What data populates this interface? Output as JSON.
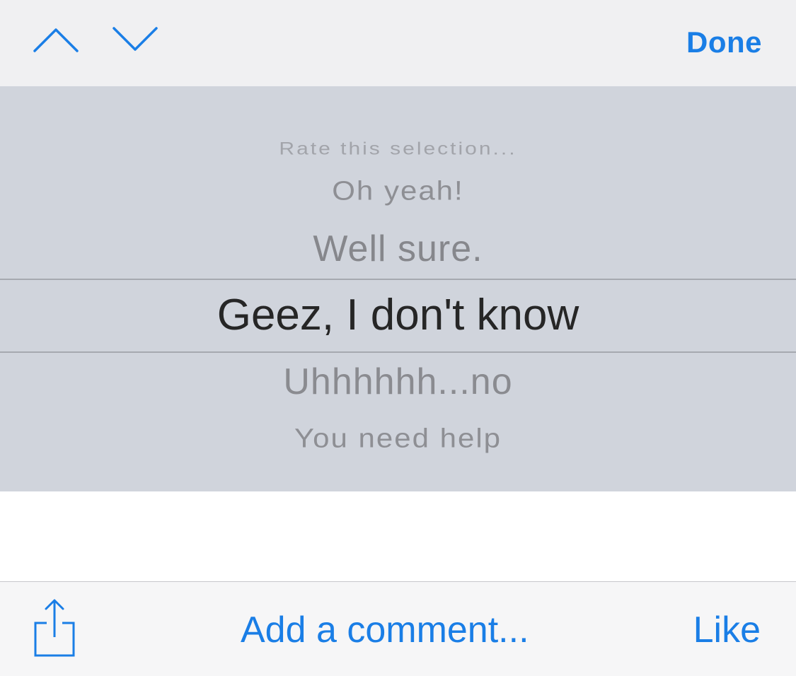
{
  "toolbar": {
    "prev_icon": "chevron-up-icon",
    "next_icon": "chevron-down-icon",
    "done_label": "Done"
  },
  "picker": {
    "options": [
      "Rate this selection...",
      "Oh yeah!",
      "Well sure.",
      "Geez, I don't know",
      "Uhhhhhh...no",
      "You need help"
    ],
    "selected": "Geez, I don't know"
  },
  "bottom_bar": {
    "share_icon": "share-icon",
    "comment_label": "Add a comment...",
    "like_label": "Like"
  },
  "colors": {
    "accent": "#1a7ee6",
    "picker_bg": "#d0d4dc",
    "toolbar_bg": "#f0f0f2"
  }
}
